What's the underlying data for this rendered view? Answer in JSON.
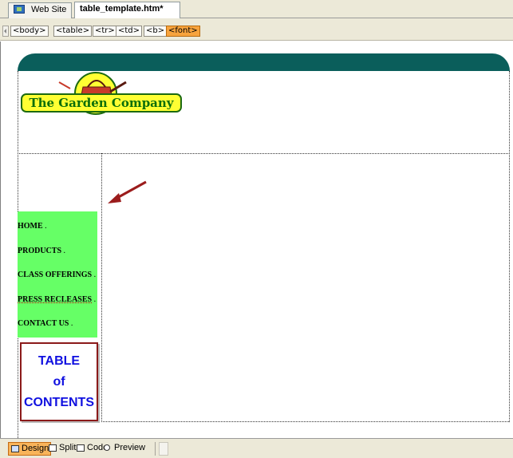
{
  "document_tabs": [
    {
      "label": "Web Site",
      "active": false
    },
    {
      "label": "table_template.htm*",
      "active": true
    }
  ],
  "tag_selector": [
    "<body>",
    "<table>",
    "<tr>",
    "<td>",
    "<b>",
    "<font>"
  ],
  "tag_selector_active": "<font>",
  "page": {
    "header_bar_color": "#0a5e5b",
    "logo_text": "The Garden Company",
    "menu_color": "#66ff66",
    "menu_items": [
      {
        "label": "HOME",
        "suffix": "."
      },
      {
        "label": "PRODUCTS",
        "suffix": "."
      },
      {
        "label": "CLASS OFFERINGS",
        "suffix": "."
      },
      {
        "label": "PRESS RECLEASES",
        "suffix": "."
      },
      {
        "label": "CONTACT US",
        "suffix": "."
      }
    ],
    "toc_lines": [
      "TABLE",
      "of",
      "CONTENTS"
    ],
    "arrow_color": "#9b1c1c"
  },
  "view_buttons": [
    {
      "label": "Design",
      "icon": "design-view-icon",
      "active": true
    },
    {
      "label": "Split",
      "icon": "split-view-icon",
      "active": false
    },
    {
      "label": "Code",
      "icon": "code-view-icon",
      "active": false
    },
    {
      "label": "Preview",
      "icon": "preview-magnifier-icon",
      "active": false
    }
  ]
}
